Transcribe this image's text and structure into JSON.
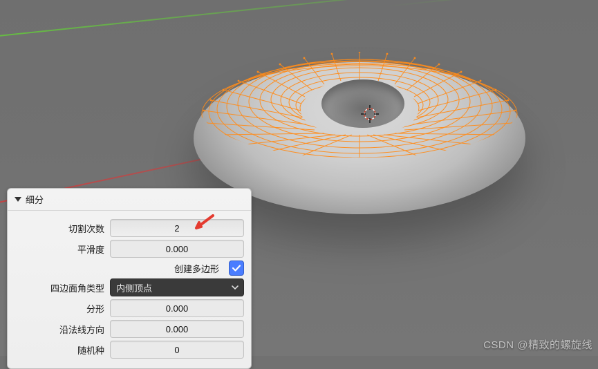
{
  "panel": {
    "title": "细分",
    "rows": {
      "cuts_label": "切割次数",
      "cuts_value": "2",
      "smooth_label": "平滑度",
      "smooth_value": "0.000",
      "ngon_label": "创建多边形",
      "ngon_checked": true,
      "corner_label": "四边面角类型",
      "corner_value": "内侧顶点",
      "fractal_label": "分形",
      "fractal_value": "0.000",
      "normal_label": "沿法线方向",
      "normal_value": "0.000",
      "seed_label": "随机种",
      "seed_value": "0"
    }
  },
  "viewport": {
    "axes": {
      "x_color": "#d24040",
      "y_color": "#6fca3e"
    },
    "selection": "torus-top-half",
    "cursor_icon": "3d-cursor"
  },
  "watermark": "CSDN @精致的螺旋线"
}
